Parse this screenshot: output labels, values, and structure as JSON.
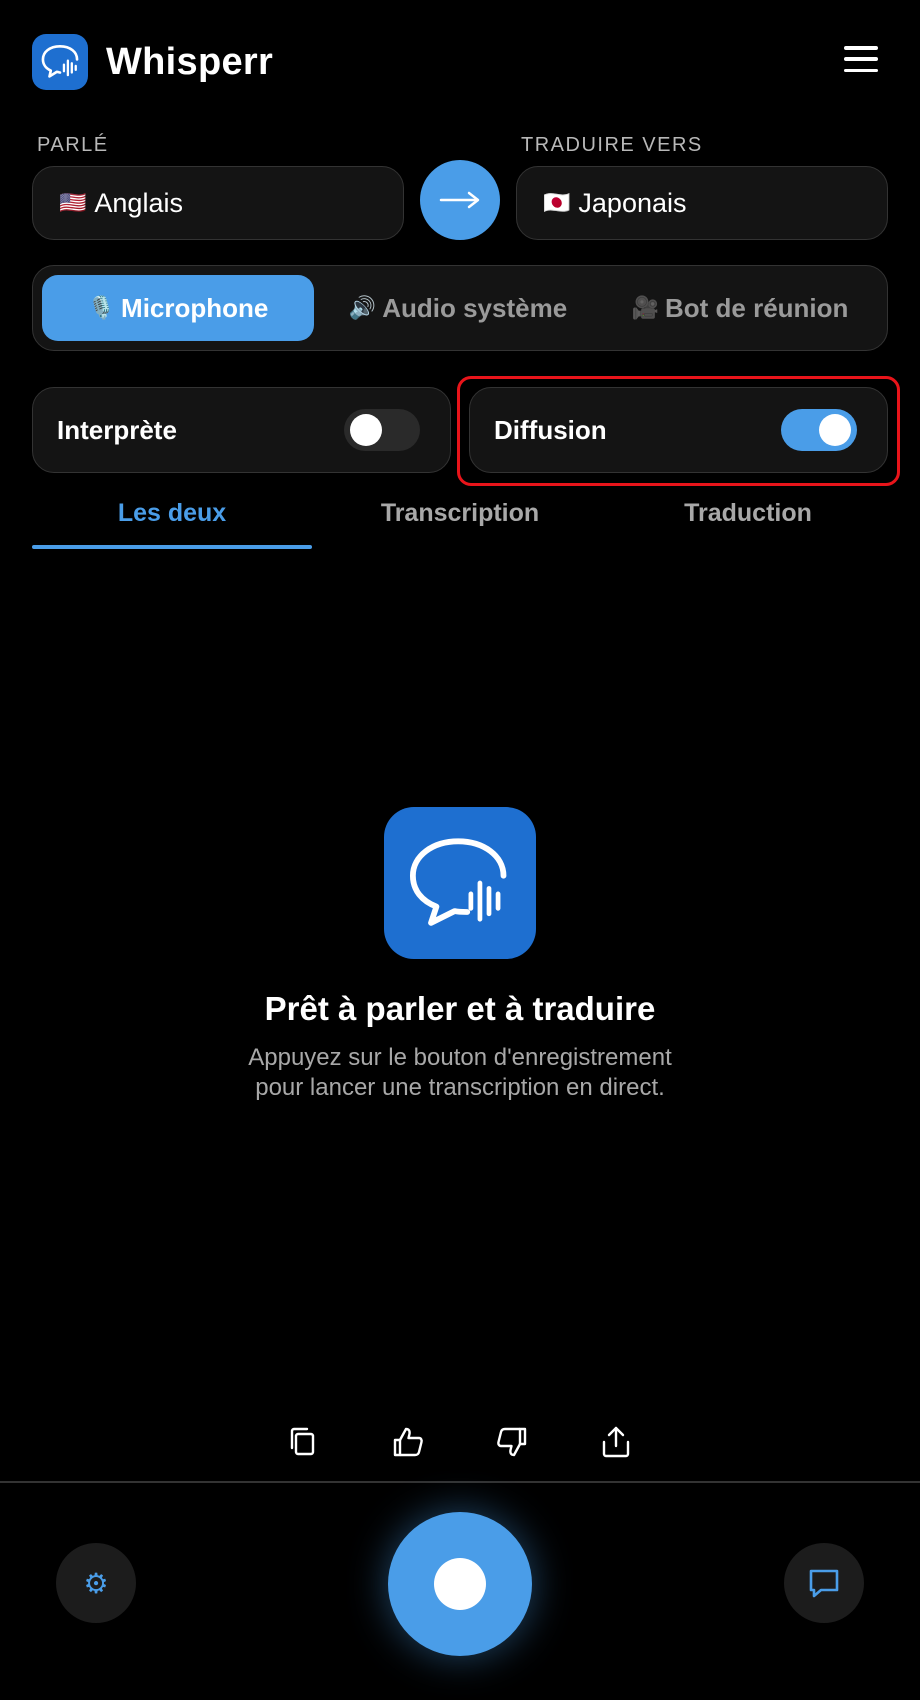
{
  "header": {
    "title": "Whisperr",
    "logo_icon": "chat-wave-icon",
    "menu_icon": "hamburger-icon"
  },
  "languages": {
    "source_label": "PARLÉ",
    "source_value": "Anglais",
    "source_flag": "🇺🇸",
    "target_label": "TRADUIRE VERS",
    "target_value": "Japonais",
    "target_flag": "🇯🇵",
    "swap_icon": "arrow-right-icon"
  },
  "sources": [
    {
      "emoji": "🎙️",
      "label": "Microphone",
      "active": true
    },
    {
      "emoji": "🔊",
      "label": "Audio système",
      "active": false
    },
    {
      "emoji": "🎥",
      "label": "Bot de réunion",
      "active": false
    }
  ],
  "toggles": {
    "interpreter": {
      "label": "Interprète",
      "on": false
    },
    "broadcast": {
      "label": "Diffusion",
      "on": true
    }
  },
  "tabs": [
    {
      "label": "Les deux",
      "active": true
    },
    {
      "label": "Transcription",
      "active": false
    },
    {
      "label": "Traduction",
      "active": false
    }
  ],
  "empty_state": {
    "title": "Prêt à parler et à traduire",
    "description": "Appuyez sur le bouton d'enregistrement pour lancer une transcription en direct."
  },
  "actions": [
    "copy-icon",
    "thumbs-up-icon",
    "thumbs-down-icon",
    "share-icon"
  ],
  "bottom_bar": {
    "settings_icon": "gear-icon",
    "record_icon": "record-icon",
    "chat_icon": "chat-icon"
  },
  "colors": {
    "accent": "#4a9de8",
    "logo_bg": "#1e6fd0",
    "highlight": "#e8141a"
  }
}
